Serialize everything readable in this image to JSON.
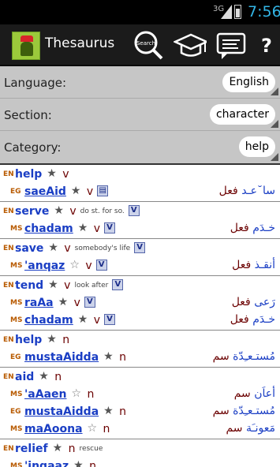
{
  "status": {
    "signal": "3G",
    "time": "7:56"
  },
  "app": {
    "title": "Thesaurus",
    "search_label": "Search"
  },
  "fields": [
    {
      "label": "Language:",
      "value": "English"
    },
    {
      "label": "Section:",
      "value": "character"
    },
    {
      "label": "Category:",
      "value": "help"
    }
  ],
  "entries": [
    {
      "lines": [
        {
          "lang": "EN",
          "word": "help",
          "underline": false,
          "star": "filled",
          "pos": "v",
          "note": "",
          "vbox": false,
          "arabic": "",
          "arabic_cat": ""
        },
        {
          "lang": "EG",
          "word": "saeAid",
          "underline": true,
          "star": "filled",
          "pos": "v",
          "note": "",
          "vbox": true,
          "vbox_label": "chat",
          "arabic": "سا˘عـد",
          "arabic_cat": "فعل"
        }
      ]
    },
    {
      "lines": [
        {
          "lang": "EN",
          "word": "serve",
          "underline": false,
          "star": "filled",
          "pos": "v",
          "note": "do st. for so.",
          "vbox": true,
          "vbox_label": "V",
          "arabic": "",
          "arabic_cat": ""
        },
        {
          "lang": "MS",
          "word": "chadam",
          "underline": true,
          "star": "filled",
          "pos": "v",
          "note": "",
          "vbox": true,
          "vbox_label": "V",
          "arabic": "خـدَم",
          "arabic_cat": "فعل"
        }
      ]
    },
    {
      "lines": [
        {
          "lang": "EN",
          "word": "save",
          "underline": false,
          "star": "filled",
          "pos": "v",
          "note": "somebody's life",
          "vbox": true,
          "vbox_label": "V",
          "arabic": "",
          "arabic_cat": ""
        },
        {
          "lang": "MS",
          "word": "'anqaz",
          "underline": true,
          "star": "hollow",
          "pos": "v",
          "note": "",
          "vbox": true,
          "vbox_label": "V",
          "arabic": "أنقـذ",
          "arabic_cat": "فعل"
        }
      ]
    },
    {
      "lines": [
        {
          "lang": "EN",
          "word": "tend",
          "underline": false,
          "star": "filled",
          "pos": "v",
          "note": "look after",
          "vbox": true,
          "vbox_label": "V",
          "arabic": "",
          "arabic_cat": ""
        },
        {
          "lang": "MS",
          "word": "raAa",
          "underline": true,
          "star": "filled",
          "pos": "v",
          "note": "",
          "vbox": true,
          "vbox_label": "V",
          "arabic": "رَعى",
          "arabic_cat": "فعل"
        },
        {
          "lang": "MS",
          "word": "chadam",
          "underline": true,
          "star": "filled",
          "pos": "v",
          "note": "",
          "vbox": true,
          "vbox_label": "V",
          "arabic": "خـدَم",
          "arabic_cat": "فعل"
        }
      ]
    },
    {
      "lines": [
        {
          "lang": "EN",
          "word": "help",
          "underline": false,
          "star": "filled",
          "pos": "n",
          "note": "",
          "vbox": false,
          "arabic": "",
          "arabic_cat": ""
        },
        {
          "lang": "EG",
          "word": "mustaAidda",
          "underline": true,
          "star": "filled",
          "pos": "n",
          "note": "",
          "vbox": false,
          "arabic": "مُستـعـِدّة",
          "arabic_cat": "سم"
        }
      ]
    },
    {
      "lines": [
        {
          "lang": "EN",
          "word": "aid",
          "underline": false,
          "star": "filled",
          "pos": "n",
          "note": "",
          "vbox": false,
          "arabic": "",
          "arabic_cat": ""
        },
        {
          "lang": "MS",
          "word": "'aAaen",
          "underline": true,
          "star": "hollow",
          "pos": "n",
          "note": "",
          "vbox": false,
          "arabic": "أعاَن",
          "arabic_cat": "سم"
        },
        {
          "lang": "EG",
          "word": "mustaAidda",
          "underline": true,
          "star": "filled",
          "pos": "n",
          "note": "",
          "vbox": false,
          "arabic": "مُستـعـِدّة",
          "arabic_cat": "سم"
        },
        {
          "lang": "MS",
          "word": "maAoona",
          "underline": true,
          "star": "hollow",
          "pos": "n",
          "note": "",
          "vbox": false,
          "arabic": "مَعونـَة",
          "arabic_cat": "سم"
        }
      ]
    },
    {
      "lines": [
        {
          "lang": "EN",
          "word": "relief",
          "underline": false,
          "star": "filled",
          "pos": "n",
          "note": "rescue",
          "vbox": false,
          "arabic": "",
          "arabic_cat": ""
        },
        {
          "lang": "MS",
          "word": "'ingaaz",
          "underline": true,
          "star": "filled",
          "pos": "n",
          "note": "",
          "vbox": false,
          "arabic": "",
          "arabic_cat": ""
        }
      ]
    }
  ]
}
